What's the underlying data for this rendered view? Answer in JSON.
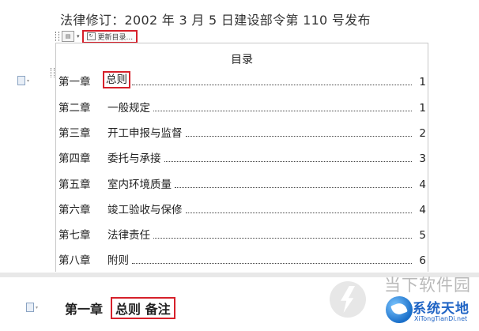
{
  "document": {
    "law_line": "法律修订：2002 年 3 月 5 日建设部令第 110 号发布"
  },
  "toc_toolbar": {
    "update_label": "更新目录..."
  },
  "toc": {
    "title": "目录",
    "entries": [
      {
        "chapter": "第一章",
        "title": "总则",
        "page": "1",
        "highlighted": true
      },
      {
        "chapter": "第二章",
        "title": "一般规定",
        "page": "1"
      },
      {
        "chapter": "第三章",
        "title": "开工申报与监督",
        "page": "2"
      },
      {
        "chapter": "第四章",
        "title": "委托与承接",
        "page": "3"
      },
      {
        "chapter": "第五章",
        "title": "室内环境质量",
        "page": "4"
      },
      {
        "chapter": "第六章",
        "title": "竣工验收与保修",
        "page": "4"
      },
      {
        "chapter": "第七章",
        "title": "法律责任",
        "page": "5"
      },
      {
        "chapter": "第八章",
        "title": "附则",
        "page": "6"
      }
    ]
  },
  "lower_section": {
    "chapter": "第一章",
    "boxed_title": "总则 备注"
  },
  "watermark": {
    "text_top": "当下软件园",
    "brand": "系统天地",
    "url": "XiTongTianDi.net"
  },
  "colors": {
    "highlight_box": "#d6202a",
    "brand_blue": "#1e63c4"
  }
}
